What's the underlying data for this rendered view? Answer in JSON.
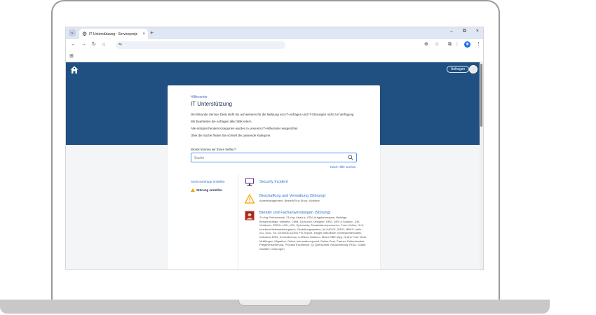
{
  "browser": {
    "tab_title": "IT Unterstützung - Serviceproje",
    "tab_close": "×",
    "new_tab": "+",
    "window_controls": [
      "–",
      "⧉",
      "×"
    ]
  },
  "header": {
    "anfragen_label": "Anfragen"
  },
  "portal": {
    "breadcrumb": "Hilfecenter",
    "title": "IT Unterstützung",
    "intro": [
      "Der Bitrunde Service Desk steht bis auf weiteres für die Meldung von IT-Anfragen und IT-Störungen nicht zur Verfügung.",
      "Wir bearbeiten die Anfragen aller SBK-intern.",
      "Alle entsprechenden Kategorien wurden in unserem IT-Hilfecenter eingerichtet.",
      "Über die Suche finden Sie schnell die passende Kategorie."
    ],
    "search_label": "Womit können wir Ihnen helfen?",
    "search_placeholder": "Suche",
    "help_link": "Nach Hilfe suchen"
  },
  "sidebar": {
    "link": "Serviceanfrage erstellen",
    "active_item": "Störung erstellen"
  },
  "services": [
    {
      "icon": "monitor-icon",
      "title": "Security Incident",
      "desc": ""
    },
    {
      "icon": "warning-icon",
      "title": "Beschaffung und Verwaltung (Störung)",
      "desc": "Assetmanagement, Bestellt Eins Shop, Monitore"
    },
    {
      "icon": "support-person-icon",
      "title": "Berater und Fachanwendungen (Störung)",
      "desc": "21c/ng Performance, 21c/ng, Abacus, ATM, Aufgabenmappe, Beiträge, Benachrichtige, bibliothe, CMM, DA Archiv, Designer, DRG, DRV e-Solution, DSt-Verfahren, EBSH, eGK, ePA, Opti-marty, Einsatzsteuerpersonen, Form Online, HLZ, Inneberichtsbearbeitungstool, Gestaltungssystem, ALLMOVE, IDRG, MBKG, hello 21c, iDoc, iTo, IDOMOD-DOSS FN, Import, Insight Interaktive, Interessentendaten, Kalkobus DRG, Kontrollschau, LuSNow, Matomo, Meine SBK iApp, Online Post, Multi, Multilingen, Migration, Online Informationsportal, Online-Post, Partner, Patientenakte, Pflegeversicherung, Process Excellence, Qi Querschnitt, Rauschierung, RDIA, Scaler, Sanitäre Leistungen"
    }
  ]
}
